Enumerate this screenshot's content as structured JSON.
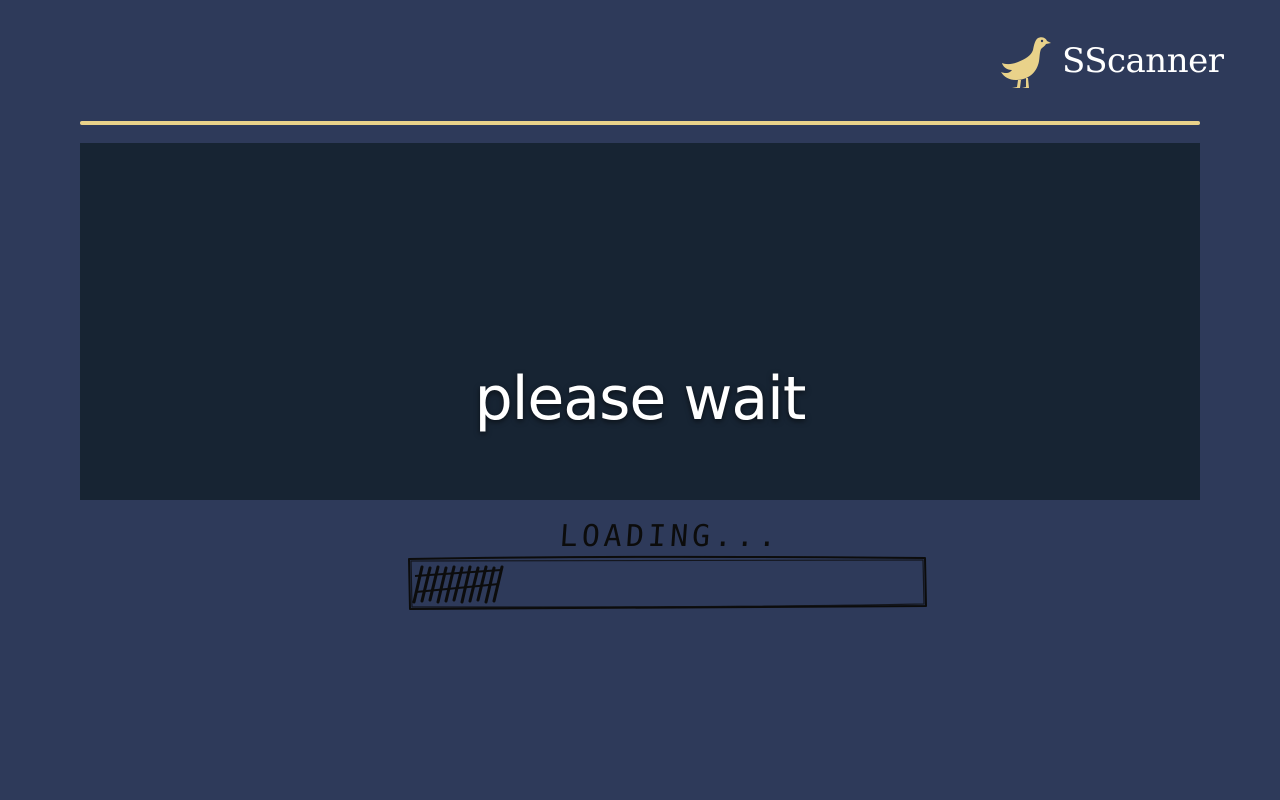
{
  "brand": {
    "name": "SScanner",
    "logo_icon": "goose-icon",
    "accent_color": "#e9d28a"
  },
  "status": {
    "message": "please wait"
  },
  "loader": {
    "label": "LOADING...",
    "progress": 0.18,
    "bar_icon": "hatched-progress-bar"
  }
}
